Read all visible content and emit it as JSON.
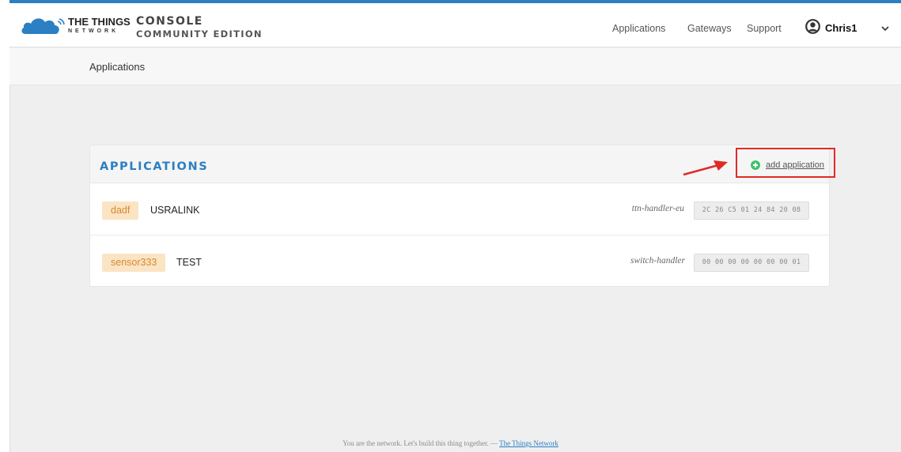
{
  "header": {
    "brand_line1": "THE THINGS",
    "brand_line2": "NETWORK",
    "console_title": "CONSOLE",
    "console_subtitle": "COMMUNITY EDITION",
    "nav": {
      "applications": "Applications",
      "gateways": "Gateways",
      "support": "Support"
    },
    "user": {
      "name": "Chris1",
      "icon": "user-avatar-icon",
      "dropdown_icon": "chevron-down-icon"
    }
  },
  "breadcrumb": {
    "current": "Applications"
  },
  "applications_card": {
    "title": "APPLICATIONS",
    "add_label": "add application",
    "add_icon": "plus-circle-icon",
    "rows": [
      {
        "app_id": "dadf",
        "description": "USRALINK",
        "handler": "ttn-handler-eu",
        "eui": "2C 26 C5 01 24 84 20 08"
      },
      {
        "app_id": "sensor333",
        "description": "TEST",
        "handler": "switch-handler",
        "eui": "00 00 00 00 00 00 00 01"
      }
    ]
  },
  "footer": {
    "text": "You are the network. Let's build this thing together. —",
    "link": "The Things Network"
  },
  "colors": {
    "accent_blue": "#2b7fc2",
    "app_id_bg": "#fbe4c4",
    "app_id_text": "#d58a2e",
    "add_icon_green": "#3fc36a",
    "annotation_red": "#e02a26"
  }
}
